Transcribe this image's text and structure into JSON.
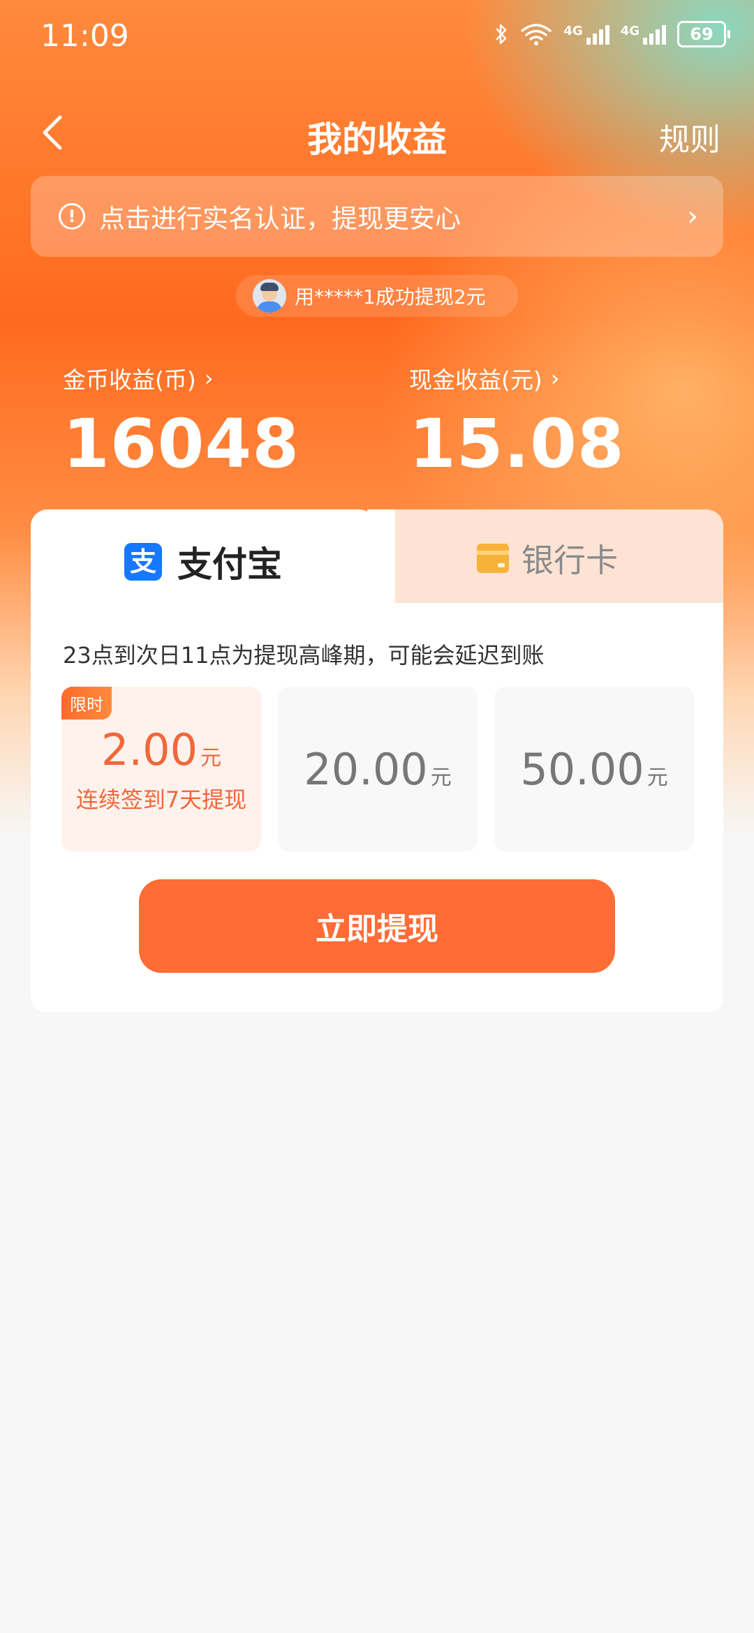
{
  "status_bar": {
    "time": "11:09",
    "network_1": "4G",
    "network_2": "4G",
    "battery": "69"
  },
  "nav": {
    "title": "我的收益",
    "rules": "规则"
  },
  "banner": {
    "text": "点击进行实名认证，提现更安心"
  },
  "ticker": {
    "text": "用*****1成功提现2元"
  },
  "earnings": {
    "coin": {
      "label": "金币收益(币)",
      "value": "16048"
    },
    "cash": {
      "label": "现金收益(元)",
      "value": "15.08"
    }
  },
  "tabs": [
    {
      "label": "支付宝",
      "icon": "alipay-icon",
      "active": true
    },
    {
      "label": "银行卡",
      "icon": "bank-card-icon",
      "active": false
    }
  ],
  "notice": "23点到次日11点为提现高峰期，可能会延迟到账",
  "amounts": [
    {
      "value": "2.00",
      "unit": "元",
      "badge": "限时",
      "subtitle": "连续签到7天提现",
      "selected": true
    },
    {
      "value": "20.00",
      "unit": "元"
    },
    {
      "value": "50.00",
      "unit": "元"
    }
  ],
  "withdraw_button": "立即提现",
  "colors": {
    "accent": "#ff6c35",
    "selected_text": "#f0673a",
    "alipay_blue": "#1677ff"
  }
}
